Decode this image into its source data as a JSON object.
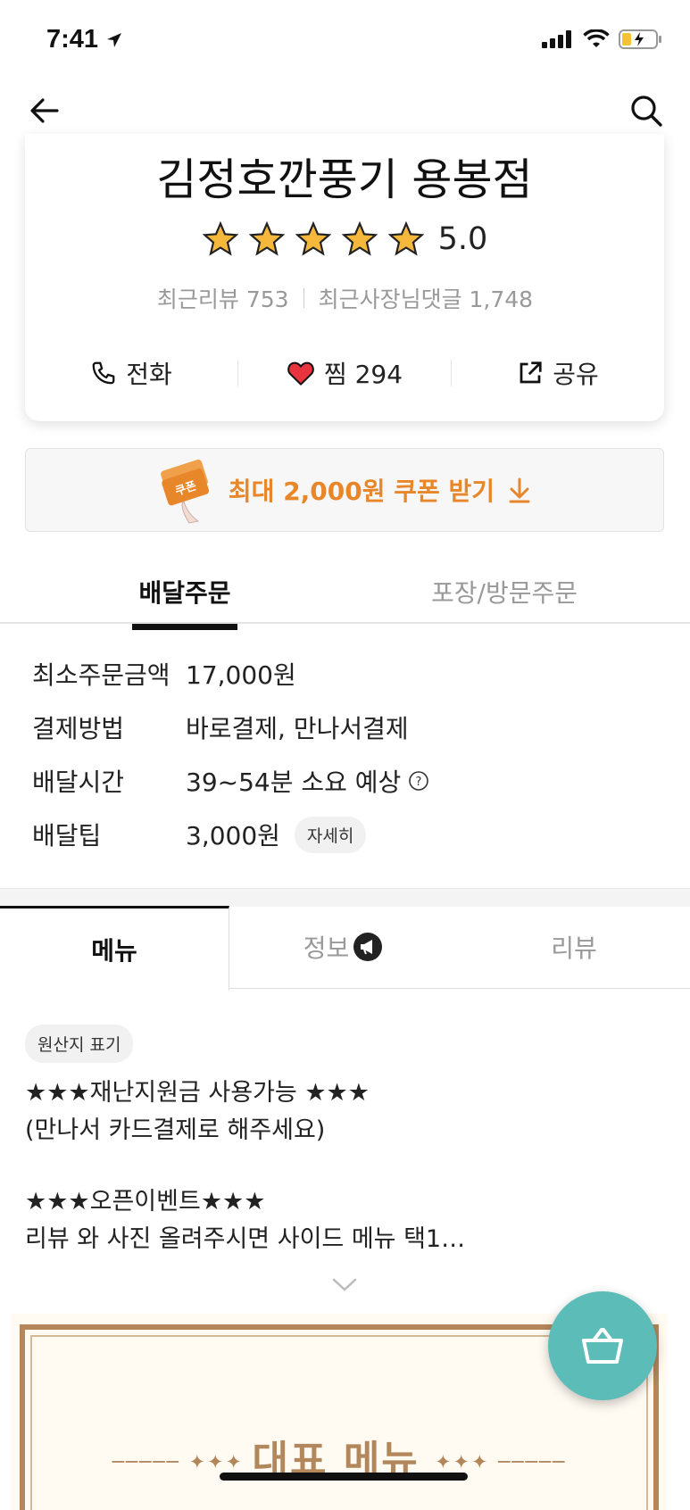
{
  "status_bar": {
    "time": "7:41"
  },
  "store": {
    "name": "김정호깐풍기 용봉점",
    "rating": "5.0",
    "recent_reviews": "최근리뷰 753",
    "owner_replies": "최근사장님댓글 1,748"
  },
  "actions": {
    "call": "전화",
    "favorite": "찜 294",
    "share": "공유"
  },
  "coupon": {
    "text": "최대 2,000원 쿠폰 받기",
    "badge": "쿠폰"
  },
  "order_tabs": {
    "delivery": "배달주문",
    "pickup": "포장/방문주문"
  },
  "delivery_info": {
    "min_order_label": "최소주문금액",
    "min_order_value": "17,000원",
    "payment_label": "결제방법",
    "payment_value": "바로결제, 만나서결제",
    "time_label": "배달시간",
    "time_value": "39~54분 소요 예상",
    "tip_label": "배달팁",
    "tip_value": "3,000원",
    "tip_detail": "자세히"
  },
  "menu_tabs": {
    "menu": "메뉴",
    "info": "정보",
    "review": "리뷰"
  },
  "origin_chip": "원산지 표기",
  "notice": {
    "line1": "★★★재난지원금 사용가능 ★★★",
    "line2": "(만나서 카드결제로 해주세요)",
    "line3": "★★★오픈이벤트★★★",
    "line4": "리뷰 와 사진 올려주시면 사이드 메뉴 택1…"
  },
  "banner": {
    "title": "대표 메뉴"
  },
  "colors": {
    "accent_orange": "#e8862a",
    "cart_teal": "#5bbcb8",
    "heart_red": "#e8343f",
    "banner_gold": "#b3875c"
  }
}
